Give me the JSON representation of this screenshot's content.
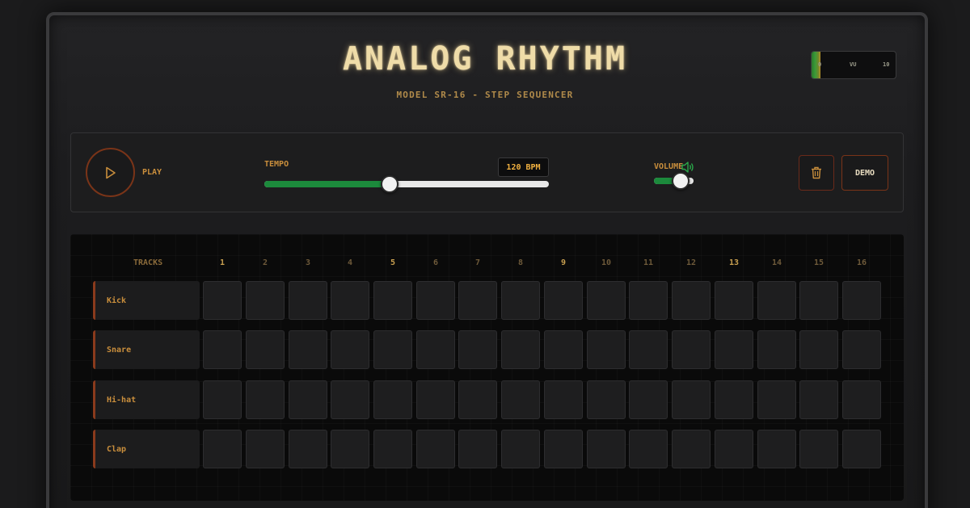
{
  "header": {
    "title": "ANALOG RHYTHM",
    "subtitle": "MODEL SR-16 - STEP SEQUENCER"
  },
  "vu_meter": {
    "min": "0",
    "mid": "VU",
    "max": "10",
    "level": 0.1
  },
  "transport": {
    "play_label": "PLAY",
    "tempo_label": "TEMPO",
    "tempo_display": "120 BPM",
    "tempo_value": 120,
    "tempo_fraction": 0.44,
    "volume_label": "VOLUME",
    "volume_fraction": 0.68,
    "demo_label": "DEMO"
  },
  "sequencer": {
    "tracks_header": "TRACKS",
    "steps": [
      "1",
      "2",
      "3",
      "4",
      "5",
      "6",
      "7",
      "8",
      "9",
      "10",
      "11",
      "12",
      "13",
      "14",
      "15",
      "16"
    ],
    "beat_steps": [
      "1",
      "5",
      "9",
      "13"
    ],
    "tracks": [
      {
        "name": "Kick"
      },
      {
        "name": "Snare"
      },
      {
        "name": "Hi-hat"
      },
      {
        "name": "Clap"
      }
    ]
  },
  "colors": {
    "accent": "#c98e3c",
    "title": "#efdca8",
    "slider_fill": "#1c8a3c",
    "border_accent": "#7a3418"
  },
  "icons": [
    "play-icon",
    "speaker-icon",
    "trash-icon"
  ]
}
